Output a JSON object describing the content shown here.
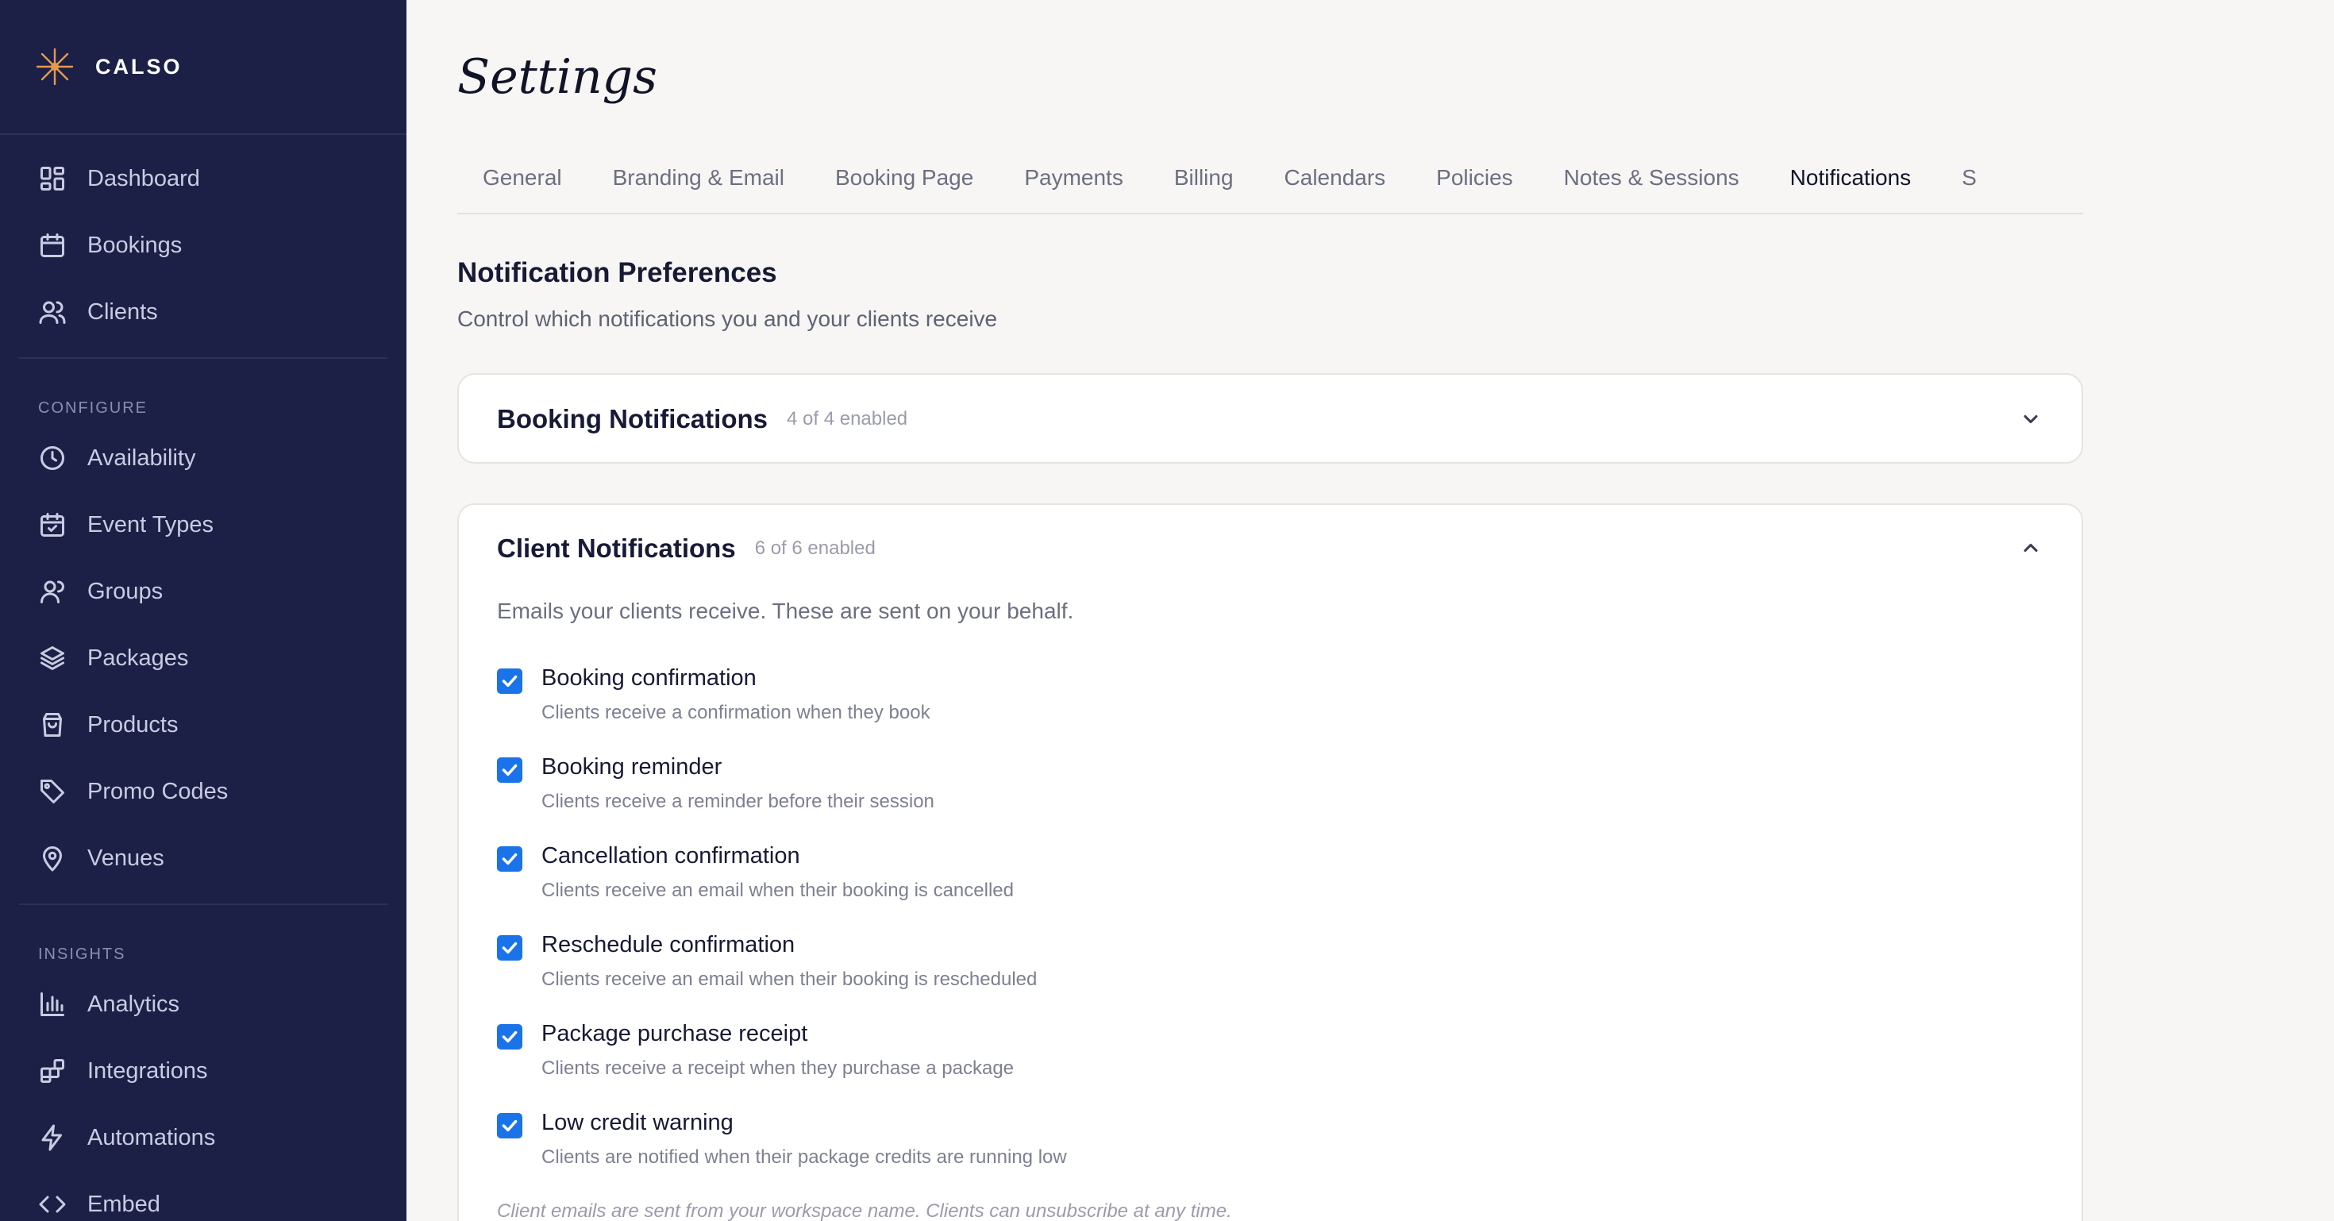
{
  "brand": {
    "name": "CALSO"
  },
  "sidebar": {
    "primary": [
      {
        "label": "Dashboard",
        "icon": "dashboard-icon"
      },
      {
        "label": "Bookings",
        "icon": "calendar-icon"
      },
      {
        "label": "Clients",
        "icon": "users-icon"
      }
    ],
    "configure_heading": "CONFIGURE",
    "configure": [
      {
        "label": "Availability",
        "icon": "clock-icon"
      },
      {
        "label": "Event Types",
        "icon": "calendar-check-icon"
      },
      {
        "label": "Groups",
        "icon": "user-group-icon"
      },
      {
        "label": "Packages",
        "icon": "layers-icon"
      },
      {
        "label": "Products",
        "icon": "shopping-bag-icon"
      },
      {
        "label": "Promo Codes",
        "icon": "tag-icon"
      },
      {
        "label": "Venues",
        "icon": "map-pin-icon"
      }
    ],
    "insights_heading": "INSIGHTS",
    "insights": [
      {
        "label": "Analytics",
        "icon": "bar-chart-icon"
      },
      {
        "label": "Integrations",
        "icon": "integrations-icon"
      },
      {
        "label": "Automations",
        "icon": "lightning-icon"
      },
      {
        "label": "Embed",
        "icon": "code-icon"
      }
    ]
  },
  "page": {
    "title": "Settings"
  },
  "tabs": [
    {
      "label": "General"
    },
    {
      "label": "Branding & Email"
    },
    {
      "label": "Booking Page"
    },
    {
      "label": "Payments"
    },
    {
      "label": "Billing"
    },
    {
      "label": "Calendars"
    },
    {
      "label": "Policies"
    },
    {
      "label": "Notes & Sessions"
    },
    {
      "label": "Notifications",
      "active": true
    },
    {
      "label": "S"
    }
  ],
  "notifications": {
    "title": "Notification Preferences",
    "subtitle": "Control which notifications you and your clients receive",
    "booking": {
      "title": "Booking Notifications",
      "count": "4 of 4 enabled",
      "expanded": false
    },
    "client": {
      "title": "Client Notifications",
      "count": "6 of 6 enabled",
      "expanded": true,
      "description": "Emails your clients receive. These are sent on your behalf.",
      "options": [
        {
          "label": "Booking confirmation",
          "desc": "Clients receive a confirmation when they book",
          "checked": true
        },
        {
          "label": "Booking reminder",
          "desc": "Clients receive a reminder before their session",
          "checked": true
        },
        {
          "label": "Cancellation confirmation",
          "desc": "Clients receive an email when their booking is cancelled",
          "checked": true
        },
        {
          "label": "Reschedule confirmation",
          "desc": "Clients receive an email when their booking is rescheduled",
          "checked": true
        },
        {
          "label": "Package purchase receipt",
          "desc": "Clients receive a receipt when they purchase a package",
          "checked": true
        },
        {
          "label": "Low credit warning",
          "desc": "Clients are notified when their package credits are running low",
          "checked": true
        }
      ],
      "footer": "Client emails are sent from your workspace name. Clients can unsubscribe at any time."
    }
  },
  "colors": {
    "sidebar_bg": "#1c2047",
    "accent": "#e39a4e",
    "checkbox": "#1a73e8",
    "page_bg": "#f7f6f4"
  }
}
